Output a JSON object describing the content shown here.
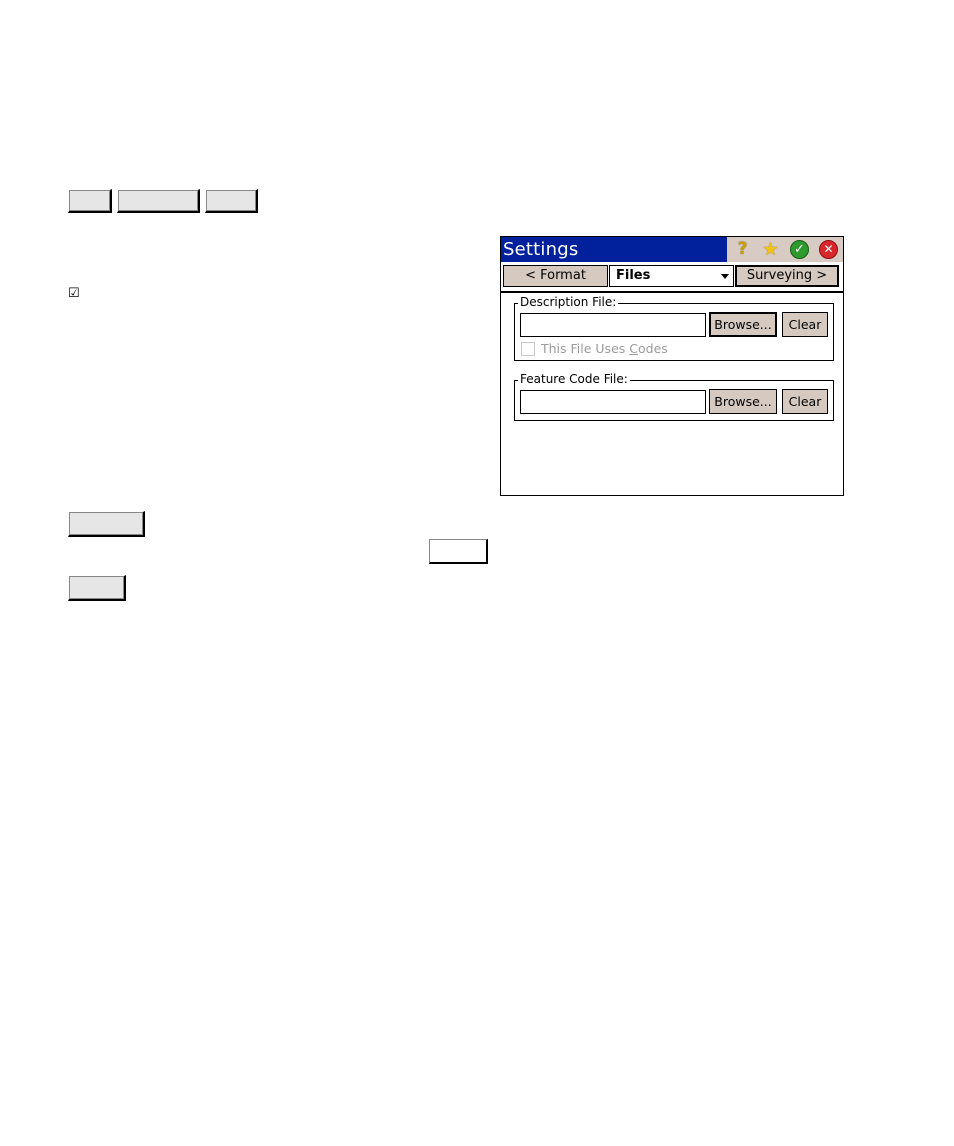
{
  "window": {
    "title": "Settings",
    "title_icons": [
      "help-icon",
      "favorites-star-icon",
      "ok-check-icon",
      "close-icon"
    ]
  },
  "nav": {
    "prev_label": "< Format",
    "page_select_value": "Files",
    "next_label": "Surveying >"
  },
  "description_group": {
    "label": "Description File:",
    "field_value": "",
    "browse_label": "Browse...",
    "clear_label": "Clear",
    "uses_codes_label_pre": "This File Uses ",
    "uses_codes_label_mnemonic": "C",
    "uses_codes_label_post": "odes",
    "uses_codes_checked": false,
    "uses_codes_enabled": false
  },
  "feature_group": {
    "label": "Feature Code File:",
    "field_value": "",
    "browse_label": "Browse...",
    "clear_label": "Clear"
  },
  "document": {
    "checkbox_symbol": "☑"
  },
  "colors": {
    "titlebar": "#00209c",
    "button_face": "#d6c9c0",
    "title_icon_area": "#d7cbc3"
  }
}
